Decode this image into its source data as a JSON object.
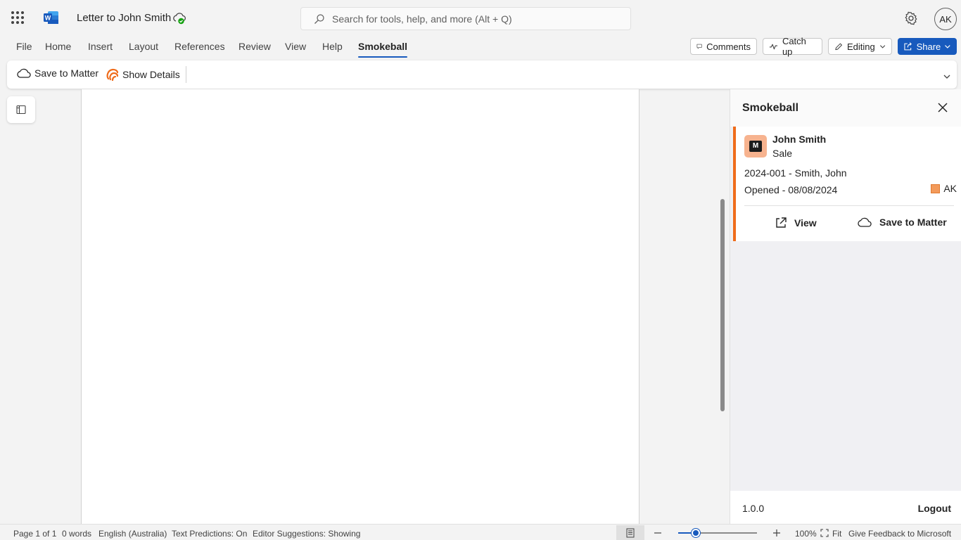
{
  "titlebar": {
    "doc_title": "Letter to John Smith",
    "search_placeholder": "Search for tools, help, and more (Alt + Q)",
    "user_initials": "AK"
  },
  "menu": {
    "tabs": [
      "File",
      "Home",
      "Insert",
      "Layout",
      "References",
      "Review",
      "View",
      "Help",
      "Smokeball"
    ],
    "active_tab": "Smokeball",
    "comments_label": "Comments",
    "catchup_label": "Catch up",
    "editing_label": "Editing",
    "share_label": "Share"
  },
  "ribbon": {
    "save_to_matter": "Save to Matter",
    "show_details": "Show Details"
  },
  "pane": {
    "title": "Smokeball",
    "client_name": "John Smith",
    "matter_type": "Sale",
    "matter_number": "2024-001 - Smith, John",
    "opened": "Opened - 08/08/2024",
    "staff_initials": "AK",
    "view_label": "View",
    "save_label": "Save to Matter",
    "version": "1.0.0",
    "logout_label": "Logout",
    "accent_color": "#ef6c1b"
  },
  "statusbar": {
    "page": "Page 1 of 1",
    "words": "0 words",
    "language": "English (Australia)",
    "predictions": "Text Predictions: On",
    "editor": "Editor Suggestions: Showing",
    "zoom": "100%",
    "zoom_level": 0.22,
    "fit": "Fit",
    "feedback": "Give Feedback to Microsoft"
  }
}
